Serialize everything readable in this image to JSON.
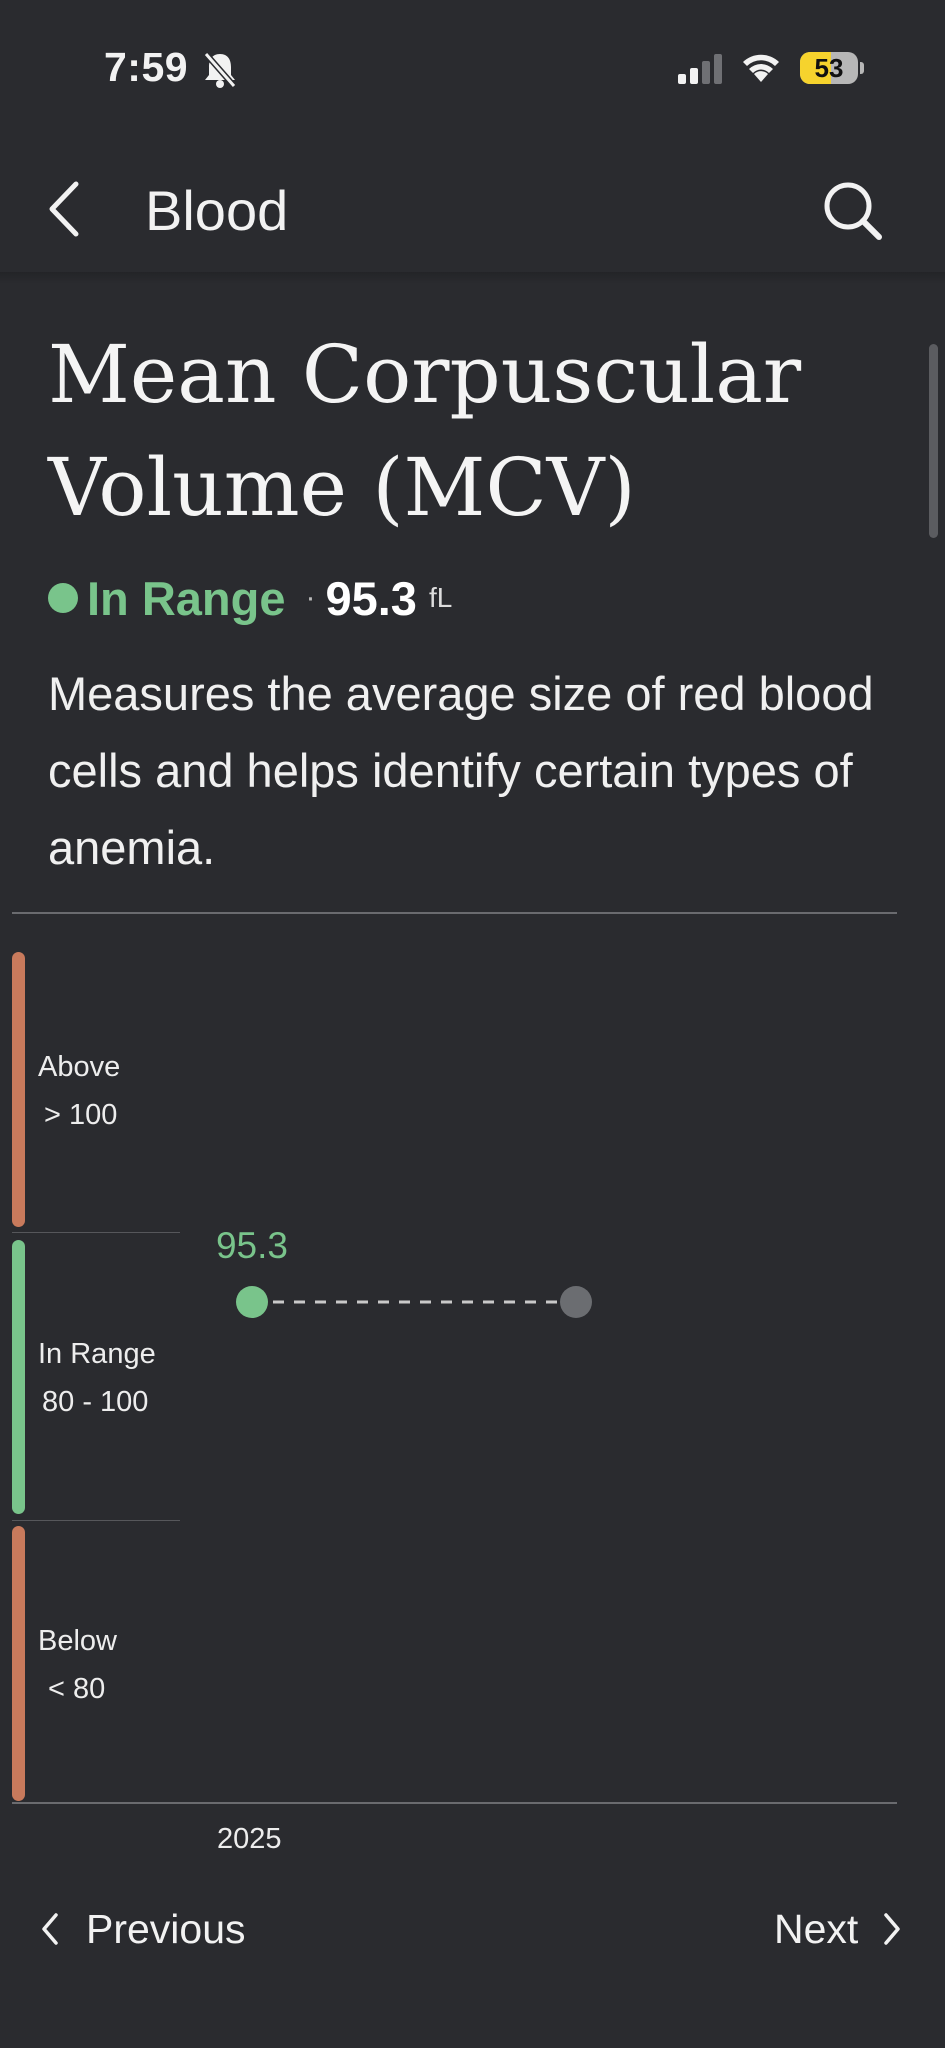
{
  "status_bar": {
    "time": "7:59",
    "battery": "53",
    "icons": [
      "bell-slash-icon",
      "cellular-signal-icon",
      "wifi-icon",
      "battery-icon"
    ]
  },
  "nav": {
    "back_icon": "chevron-left-icon",
    "title": "Blood",
    "search_icon": "search-icon"
  },
  "marker": {
    "title_line1": "Mean Corpuscular",
    "title_line2": "Volume (MCV)",
    "status": "In Range",
    "separator": "·",
    "value": "95.3",
    "unit": "fL",
    "description": "Measures the average size of red blood cells and helps identify certain types of anemia."
  },
  "colors": {
    "background": "#2a2b2f",
    "in_range": "#79c48b",
    "out_of_range": "#c87a5c",
    "placeholder_point": "#6b6d71"
  },
  "chart_data": {
    "type": "scatter",
    "bands": [
      {
        "name": "Above",
        "range": "> 100",
        "color": "#c87a5c"
      },
      {
        "name": "In Range",
        "range": "80 - 100",
        "color": "#79c48b"
      },
      {
        "name": "Below",
        "range": "< 80",
        "color": "#c87a5c"
      }
    ],
    "x_ticks": [
      "2025"
    ],
    "points": [
      {
        "x": "2025",
        "y": 95.3,
        "label": "95.3",
        "color": "#79c48b"
      }
    ],
    "trailing_placeholder": true
  },
  "footer": {
    "previous_label": "Previous",
    "next_label": "Next"
  }
}
